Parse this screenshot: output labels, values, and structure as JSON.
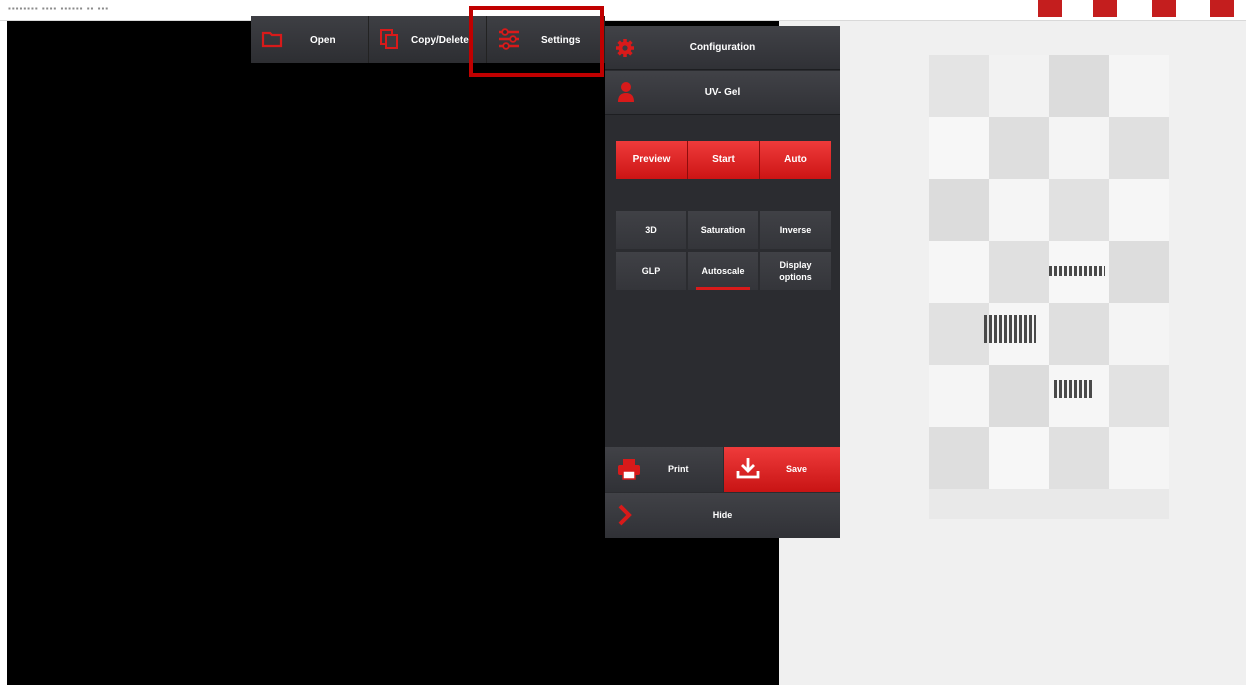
{
  "toolbar": {
    "open_label": "Open",
    "copy_delete_label": "Copy/Delete",
    "settings_label": "Settings"
  },
  "panel": {
    "configuration_label": "Configuration",
    "mode_label": "UV- Gel",
    "actions": [
      {
        "label": "Preview"
      },
      {
        "label": "Start"
      },
      {
        "label": "Auto"
      }
    ],
    "view_options": [
      {
        "label": "3D"
      },
      {
        "label": "Saturation"
      },
      {
        "label": "Inverse"
      },
      {
        "label": "GLP"
      },
      {
        "label": "Autoscale"
      },
      {
        "label": "Display options"
      }
    ],
    "print_label": "Print",
    "save_label": "Save",
    "hide_label": "Hide"
  },
  "colors": {
    "accent_red": "#d81a1a",
    "panel_dark": "#2b2c30",
    "highlight_frame": "#c00000"
  },
  "icons": [
    "folder-icon",
    "copy-icon",
    "sliders-icon",
    "gear-icon",
    "user-icon",
    "printer-icon",
    "download-icon",
    "chevron-right-icon"
  ]
}
